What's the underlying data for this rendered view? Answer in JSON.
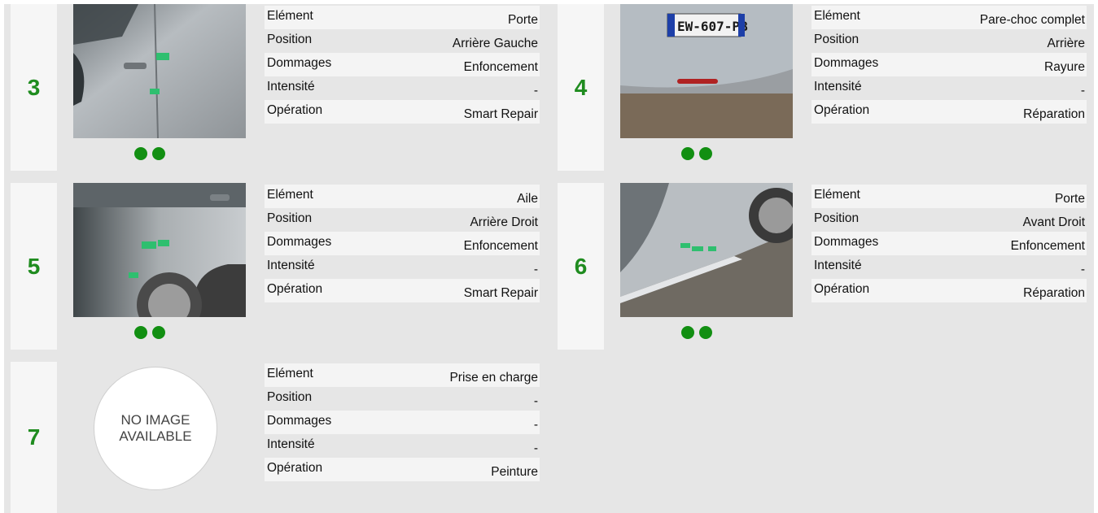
{
  "labels": {
    "element": "Elément",
    "position": "Position",
    "dommages": "Dommages",
    "intensite": "Intensité",
    "operation": "Opération"
  },
  "cards": [
    {
      "number": "3",
      "element": "Porte",
      "position": "Arrière Gauche",
      "dommages": "Enfoncement",
      "intensite": "-",
      "operation": "Smart Repair",
      "photo": "car-rear-left-door-photo"
    },
    {
      "number": "4",
      "element": "Pare-choc complet",
      "position": "Arrière",
      "dommages": "Rayure",
      "intensite": "-",
      "operation": "Réparation",
      "photo": "car-rear-bumper-photo",
      "plate": "EW-607-PB"
    },
    {
      "number": "5",
      "element": "Aile",
      "position": "Arrière Droit",
      "dommages": "Enfoncement",
      "intensite": "-",
      "operation": "Smart Repair",
      "photo": "car-rear-right-wing-photo"
    },
    {
      "number": "6",
      "element": "Porte",
      "position": "Avant Droit",
      "dommages": "Enfoncement",
      "intensite": "-",
      "operation": "Réparation",
      "photo": "car-front-right-door-photo"
    },
    {
      "number": "7",
      "element": "Prise en charge",
      "position": "-",
      "dommages": "-",
      "intensite": "-",
      "operation": "Peinture",
      "no_image_line1": "NO IMAGE",
      "no_image_line2": "AVAILABLE"
    }
  ],
  "colors": {
    "accent_green": "#1f8c1f",
    "dot_green": "#128f12",
    "background": "#e6e6e6"
  }
}
